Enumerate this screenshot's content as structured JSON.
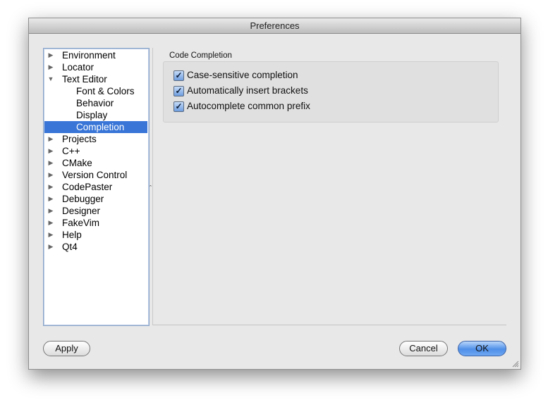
{
  "window": {
    "title": "Preferences"
  },
  "sidebar": {
    "items": [
      {
        "label": "Environment",
        "level": 0,
        "expander": "collapsed",
        "selected": false
      },
      {
        "label": "Locator",
        "level": 0,
        "expander": "collapsed",
        "selected": false
      },
      {
        "label": "Text Editor",
        "level": 0,
        "expander": "expanded",
        "selected": false
      },
      {
        "label": "Font & Colors",
        "level": 1,
        "expander": "none",
        "selected": false
      },
      {
        "label": "Behavior",
        "level": 1,
        "expander": "none",
        "selected": false
      },
      {
        "label": "Display",
        "level": 1,
        "expander": "none",
        "selected": false
      },
      {
        "label": "Completion",
        "level": 1,
        "expander": "none",
        "selected": true
      },
      {
        "label": "Projects",
        "level": 0,
        "expander": "collapsed",
        "selected": false
      },
      {
        "label": "C++",
        "level": 0,
        "expander": "collapsed",
        "selected": false
      },
      {
        "label": "CMake",
        "level": 0,
        "expander": "collapsed",
        "selected": false
      },
      {
        "label": "Version Control",
        "level": 0,
        "expander": "collapsed",
        "selected": false
      },
      {
        "label": "CodePaster",
        "level": 0,
        "expander": "collapsed",
        "selected": false
      },
      {
        "label": "Debugger",
        "level": 0,
        "expander": "collapsed",
        "selected": false
      },
      {
        "label": "Designer",
        "level": 0,
        "expander": "collapsed",
        "selected": false
      },
      {
        "label": "FakeVim",
        "level": 0,
        "expander": "collapsed",
        "selected": false
      },
      {
        "label": "Help",
        "level": 0,
        "expander": "collapsed",
        "selected": false
      },
      {
        "label": "Qt4",
        "level": 0,
        "expander": "collapsed",
        "selected": false
      }
    ]
  },
  "main": {
    "section_title": "Code Completion",
    "options": [
      {
        "label": "Case-sensitive completion",
        "checked": true
      },
      {
        "label": "Automatically insert brackets",
        "checked": true
      },
      {
        "label": "Autocomplete common prefix",
        "checked": true
      }
    ]
  },
  "buttons": {
    "apply": "Apply",
    "cancel": "Cancel",
    "ok": "OK"
  },
  "colors": {
    "selection": "#3875d7",
    "default_button": "#4f8fe8",
    "window_bg": "#e8e8e8"
  }
}
